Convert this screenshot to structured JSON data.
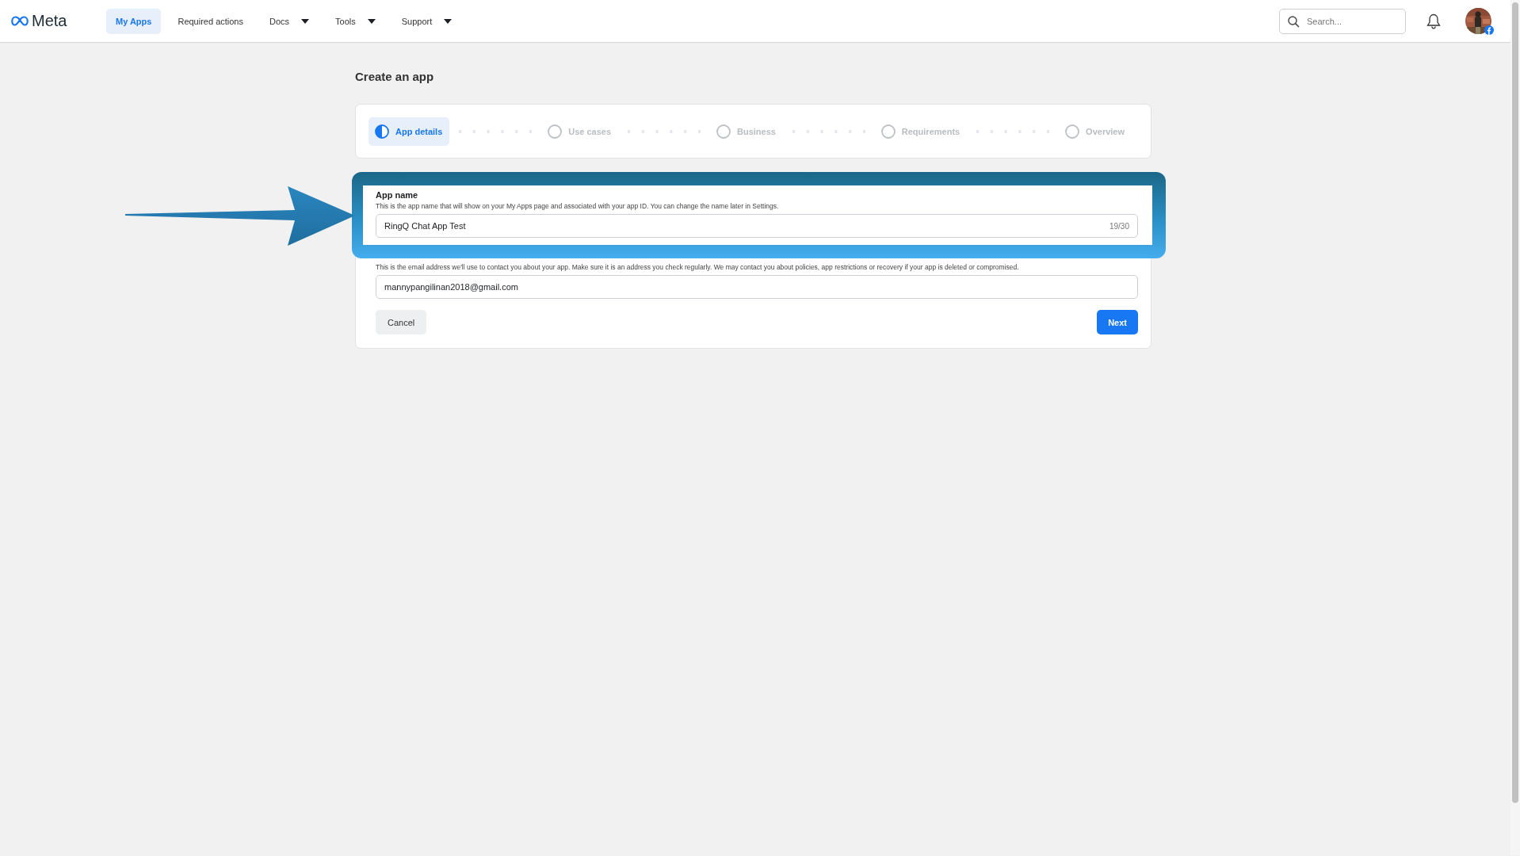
{
  "nav": {
    "logo_text": "Meta",
    "items": [
      {
        "label": "My Apps",
        "selected": true,
        "dropdown": false
      },
      {
        "label": "Required actions",
        "selected": false,
        "dropdown": false
      },
      {
        "label": "Docs",
        "selected": false,
        "dropdown": true
      },
      {
        "label": "Tools",
        "selected": false,
        "dropdown": true
      },
      {
        "label": "Support",
        "selected": false,
        "dropdown": true
      }
    ],
    "search": {
      "placeholder": "Search..."
    }
  },
  "page_title": "Create an app",
  "steps": [
    {
      "label": "App details",
      "selected": true
    },
    {
      "label": "Use cases",
      "selected": false
    },
    {
      "label": "Business",
      "selected": false
    },
    {
      "label": "Requirements",
      "selected": false
    },
    {
      "label": "Overview",
      "selected": false
    }
  ],
  "form": {
    "fields": [
      {
        "label": "App name",
        "description": "This is the app name that will show on your My Apps page and associated with your app ID. You can change the name later in Settings.",
        "value": "RingQ Chat App Test",
        "counter": "19/30",
        "highlighted": true
      },
      {
        "description": "This is the email address we'll use to contact you about your app. Make sure it is an address you check regularly. We may contact you about policies, app restrictions or recovery if your app is deleted or compromised.",
        "value": "mannypangilinan2018@gmail.com",
        "highlighted": false
      }
    ],
    "buttons": [
      {
        "label": "Cancel",
        "kind": "secondary"
      },
      {
        "label": "Next",
        "kind": "primary"
      }
    ]
  }
}
